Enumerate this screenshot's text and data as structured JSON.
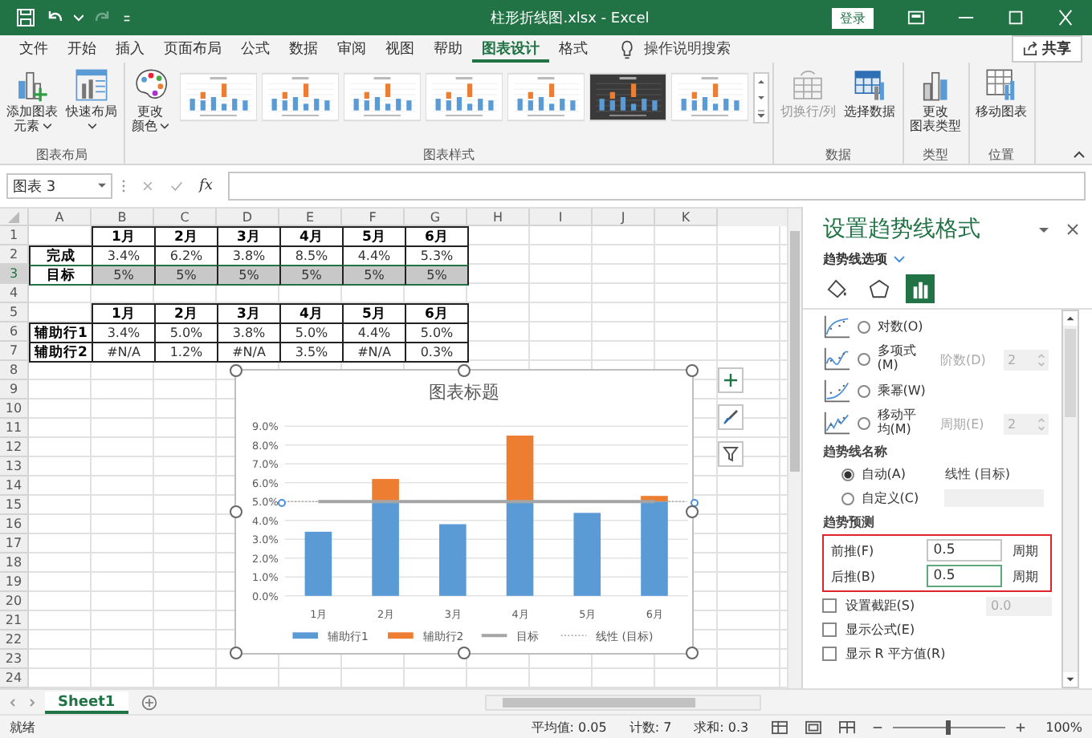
{
  "window": {
    "title": "柱形折线图.xlsx - Excel",
    "sign_in": "登录"
  },
  "menu_tabs": [
    {
      "label": "文件",
      "selected": false
    },
    {
      "label": "开始",
      "selected": false
    },
    {
      "label": "插入",
      "selected": false
    },
    {
      "label": "页面布局",
      "selected": false
    },
    {
      "label": "公式",
      "selected": false
    },
    {
      "label": "数据",
      "selected": false
    },
    {
      "label": "审阅",
      "selected": false
    },
    {
      "label": "视图",
      "selected": false
    },
    {
      "label": "帮助",
      "selected": false
    },
    {
      "label": "图表设计",
      "selected": true
    },
    {
      "label": "格式",
      "selected": false
    }
  ],
  "tell_me": "操作说明搜索",
  "share": "共享",
  "ribbon_groups": [
    {
      "label": "图表布局",
      "buttons": [
        {
          "kind": "add-element",
          "lines": [
            "添加图表",
            "元素"
          ],
          "dropdown": true,
          "disabled": false
        },
        {
          "kind": "quick-layout",
          "lines": [
            "快速布局"
          ],
          "dropdown": true,
          "disabled": false
        }
      ]
    },
    {
      "label": "图表样式",
      "buttons": [
        {
          "kind": "colors",
          "lines": [
            "更改",
            "颜色"
          ],
          "dropdown": true,
          "disabled": false
        }
      ],
      "gallery": [
        {
          "dark": false
        },
        {
          "dark": false
        },
        {
          "dark": false
        },
        {
          "dark": false
        },
        {
          "dark": false
        },
        {
          "dark": true
        },
        {
          "dark": false
        }
      ]
    },
    {
      "label": "数据",
      "buttons": [
        {
          "kind": "switch",
          "lines": [
            "切换行/列"
          ],
          "dropdown": false,
          "disabled": true
        },
        {
          "kind": "select-data",
          "lines": [
            "选择数据"
          ],
          "dropdown": false,
          "disabled": false
        }
      ]
    },
    {
      "label": "类型",
      "buttons": [
        {
          "kind": "change-type",
          "lines": [
            "更改",
            "图表类型"
          ],
          "dropdown": false,
          "disabled": false
        }
      ]
    },
    {
      "label": "位置",
      "buttons": [
        {
          "kind": "move",
          "lines": [
            "移动图表"
          ],
          "dropdown": false,
          "disabled": false
        }
      ]
    }
  ],
  "formula_bar": {
    "name_box": "图表 3",
    "function_label": "fx"
  },
  "sheet": {
    "columns": [
      "A",
      "B",
      "C",
      "D",
      "E",
      "F",
      "G",
      "H",
      "I",
      "J",
      "K"
    ],
    "rows": [
      {
        "header": "1",
        "kind": "header",
        "selected": false,
        "cells": [
          null,
          "1月",
          "2月",
          "3月",
          "4月",
          "5月",
          "6月"
        ]
      },
      {
        "header": "2",
        "kind": "data",
        "selected": false,
        "cells": [
          "完成",
          "3.4%",
          "6.2%",
          "3.8%",
          "8.5%",
          "4.4%",
          "5.3%"
        ]
      },
      {
        "header": "3",
        "kind": "data",
        "selected": true,
        "cells": [
          "目标",
          "5%",
          "5%",
          "5%",
          "5%",
          "5%",
          "5%"
        ]
      },
      {
        "header": "4"
      },
      {
        "header": "5",
        "kind": "header",
        "selected": false,
        "cells": [
          null,
          "1月",
          "2月",
          "3月",
          "4月",
          "5月",
          "6月"
        ]
      },
      {
        "header": "6",
        "kind": "data",
        "selected": false,
        "cells": [
          "辅助行1",
          "3.4%",
          "5.0%",
          "3.8%",
          "5.0%",
          "4.4%",
          "5.0%"
        ]
      },
      {
        "header": "7",
        "kind": "data",
        "selected": false,
        "cells": [
          "辅助行2",
          "#N/A",
          "1.2%",
          "#N/A",
          "3.5%",
          "#N/A",
          "0.3%"
        ]
      },
      {
        "header": "8"
      },
      {
        "header": "9"
      },
      {
        "header": "10"
      },
      {
        "header": "11"
      },
      {
        "header": "12"
      },
      {
        "header": "13"
      },
      {
        "header": "14"
      },
      {
        "header": "15"
      },
      {
        "header": "16"
      },
      {
        "header": "17"
      },
      {
        "header": "18"
      },
      {
        "header": "19"
      },
      {
        "header": "20"
      },
      {
        "header": "21"
      },
      {
        "header": "22"
      },
      {
        "header": "23"
      },
      {
        "header": "24"
      }
    ],
    "chart": {
      "chart_data": {
        "type": "bar",
        "title": "图表标题",
        "stacked": true,
        "grid": true,
        "legend": "bottom",
        "categories": [
          "1月",
          "2月",
          "3月",
          "4月",
          "5月",
          "6月"
        ],
        "ylim": [
          0,
          9
        ],
        "yticks": [
          {
            "value": 0,
            "label": "0.0%"
          },
          {
            "value": 1,
            "label": "1.0%"
          },
          {
            "value": 2,
            "label": "2.0%"
          },
          {
            "value": 3,
            "label": "3.0%"
          },
          {
            "value": 4,
            "label": "4.0%"
          },
          {
            "value": 5,
            "label": "5.0%"
          },
          {
            "value": 6,
            "label": "6.0%"
          },
          {
            "value": 7,
            "label": "7.0%"
          },
          {
            "value": 8,
            "label": "8.0%"
          },
          {
            "value": 9,
            "label": "9.0%"
          }
        ],
        "series": [
          {
            "name": "辅助行1",
            "type": "bar",
            "color": "#5b9bd5",
            "values": [
              3.4,
              5.0,
              3.8,
              5.0,
              4.4,
              5.0
            ]
          },
          {
            "name": "辅助行2",
            "type": "bar",
            "color": "#ed7d31",
            "values": [
              null,
              1.2,
              null,
              3.5,
              null,
              0.3
            ]
          },
          {
            "name": "目标",
            "type": "line",
            "color": "#a5a5a5",
            "values": [
              5,
              5,
              5,
              5,
              5,
              5
            ]
          }
        ],
        "ref_lines": [
          {
            "axis": "y",
            "value": 5,
            "label": "线性 (目标)",
            "color": "#a5a5a5"
          }
        ]
      }
    }
  },
  "sheet_tabs": [
    {
      "label": "Sheet1",
      "selected": true
    }
  ],
  "format_pane": {
    "title": "设置趋势线格式",
    "section": "趋势线选项",
    "icon_tabs": [
      {
        "kind": "fill",
        "selected": false
      },
      {
        "kind": "effects",
        "selected": false
      },
      {
        "kind": "options",
        "selected": true
      }
    ],
    "trend_types": [
      {
        "kind": "log",
        "label": "对数(O)",
        "selected": false
      },
      {
        "kind": "poly",
        "label": "多项式(M)",
        "selected": false,
        "param": {
          "label": "阶数(D)",
          "value": "2",
          "disabled": true
        }
      },
      {
        "kind": "power",
        "label": "乘幂(W)",
        "selected": false
      },
      {
        "kind": "moving",
        "label": "移动平均(M)",
        "selected": false,
        "param": {
          "label": "周期(E)",
          "value": "2",
          "disabled": true
        }
      }
    ],
    "name_label": "趋势线名称",
    "name_options": [
      {
        "label": "自动(A)",
        "selected": true,
        "value": "线性 (目标)"
      },
      {
        "label": "自定义(C)",
        "selected": false
      }
    ],
    "forecast_label": "趋势预测",
    "forecast_highlighted": true,
    "forecast": [
      {
        "label": "前推(F)",
        "value": "0.5",
        "unit": "周期",
        "focused": false
      },
      {
        "label": "后推(B)",
        "value": "0.5",
        "unit": "周期",
        "focused": true
      }
    ],
    "checks": [
      {
        "label": "设置截距(S)",
        "checked": false,
        "value": "0.0",
        "value_disabled": true
      },
      {
        "label": "显示公式(E)",
        "checked": false
      },
      {
        "label": "显示 R 平方值(R)",
        "checked": false
      }
    ]
  },
  "status_bar": {
    "status": "就绪",
    "stats": [
      "平均值: 0.05",
      "计数: 7",
      "求和: 0.3"
    ],
    "zoom": {
      "level": 0.5,
      "label": "100%"
    }
  }
}
